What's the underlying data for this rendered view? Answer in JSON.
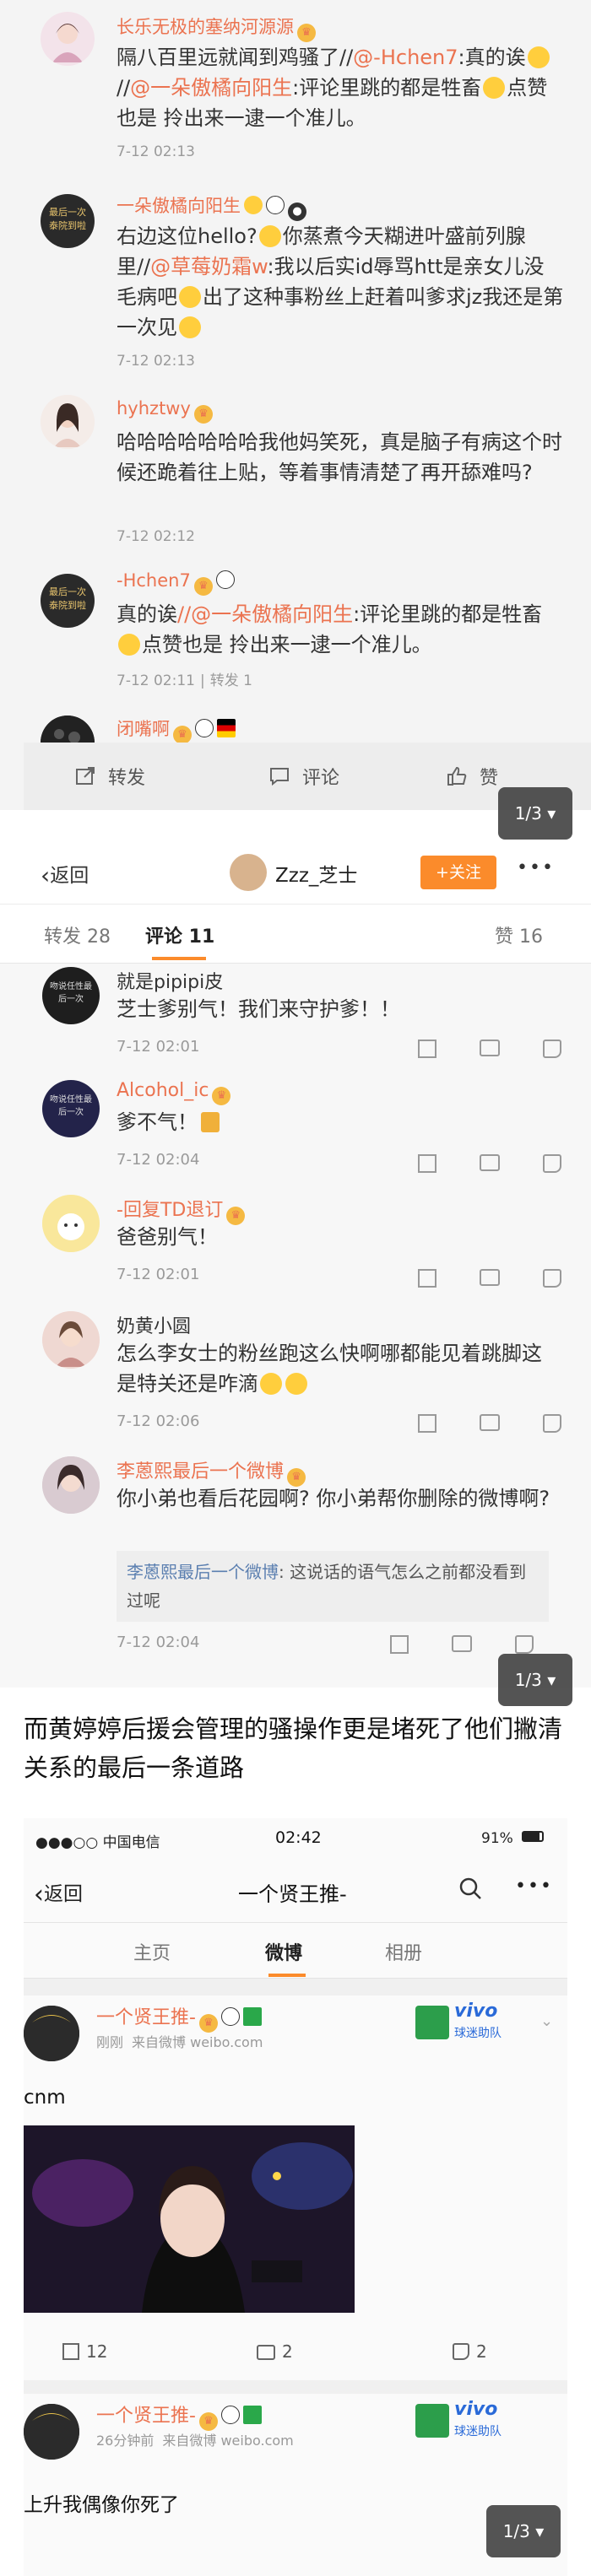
{
  "panel1": {
    "comments": [
      {
        "user": "长乐无极的塞纳河源源",
        "text_plain": "隔八百里远就闻到鸡骚了//",
        "text_mention": "@-Hchen7",
        "text_rest": ":真的诶",
        "text_rest2": "//",
        "text_mention2": "@一朵傲橘向阳生",
        "text_rest3": ":评论里跳的都是牲畜",
        "text_rest4": "点赞也是 拎出来一逮一个准儿。",
        "time": "7-12 02:13"
      },
      {
        "user": "一朵傲橘向阳生",
        "avatar_text": "最后一次泰院到啦",
        "text_a": "右边这位hello?",
        "text_b": "你蒸煮今天糊进叶盛前列腺里//",
        "text_mention": "@草莓奶霜w",
        "text_c": ":我以后实id辱骂htt是亲女儿没毛病吧",
        "text_d": "出了这种事粉丝上赶着叫爹求jz我还是第一次见",
        "time": "7-12 02:13"
      },
      {
        "user": "hyhztwy",
        "text": "哈哈哈哈哈哈哈我他妈笑死，真是脑子有病这个时候还跪着往上贴，等着事情清楚了再开舔难吗?",
        "time": "7-12 02:12"
      },
      {
        "user": "-Hchen7",
        "avatar_text": "最后一次泰院到啦",
        "text_a": "真的诶",
        "text_mention": "//@一朵傲橘向阳生",
        "text_b": ":评论里跳的都是牲畜",
        "text_c": "点赞也是 拎出来一逮一个准儿。",
        "time": "7-12 02:11",
        "reply": "转发 1"
      },
      {
        "user": "闭嘴啊"
      }
    ],
    "bar": {
      "repost": "转发",
      "comment": "评论",
      "like": "赞"
    },
    "page_indicator": "1/3 ▾"
  },
  "panel2": {
    "back": "返回",
    "user": "Zzz_芝士",
    "follow": "+关注",
    "more": "•••",
    "tab_repost": "转发 28",
    "tab_comment": "评论 11",
    "tab_like": "赞 16",
    "comments": [
      {
        "user": "就是pipipi皮",
        "avatar_text": "吻说任性最后一次",
        "text": "芝士爹别气！我们来守护爹！！",
        "time": "7-12 02:01"
      },
      {
        "user": "Alcohol_ic",
        "avatar_text": "吻说任性最后一次",
        "text": "爹不气！",
        "time": "7-12 02:04"
      },
      {
        "user": "-回复TD退订",
        "text": "爸爸别气！",
        "time": "7-12 02:01"
      },
      {
        "user": "奶黄小圆",
        "text": "怎么李女士的粉丝跑这么快啊哪都能见着跳脚这是特关还是咋滴",
        "time": "7-12 02:06"
      },
      {
        "user": "李蒽熙最后一个微博",
        "text": "你小弟也看后花园啊? 你小弟帮你删除的微博啊?",
        "reply_user": "李蒽熙最后一个微博",
        "reply_text": ": 这说话的语气怎么之前都没看到过呢",
        "time": "7-12 02:04"
      }
    ],
    "page_indicator": "1/3 ▾"
  },
  "caption": "而黄婷婷后援会管理的骚操作更是堵死了他们撇清关系的最后一条道路",
  "panel3": {
    "status_left": "●●●○○ 中国电信",
    "status_time": "02:42",
    "status_right": "91%",
    "back": "返回",
    "title": "一个贤王推-",
    "tab_home": "主页",
    "tab_weibo": "微博",
    "tab_album": "相册",
    "vivo_text": "vivo",
    "vivo_sub": "球迷助队",
    "posts": [
      {
        "user": "一个贤王推-",
        "meta_time": "刚刚",
        "meta_src": "来自微博 weibo.com",
        "text": "cnm",
        "reposts": "12",
        "comments": "2",
        "likes": "2"
      },
      {
        "user": "一个贤王推-",
        "meta_time": "26分钟前",
        "meta_src": "来自微博 weibo.com",
        "text": "上升我偶像你死了"
      }
    ],
    "page_indicator": "1/3 ▾"
  }
}
